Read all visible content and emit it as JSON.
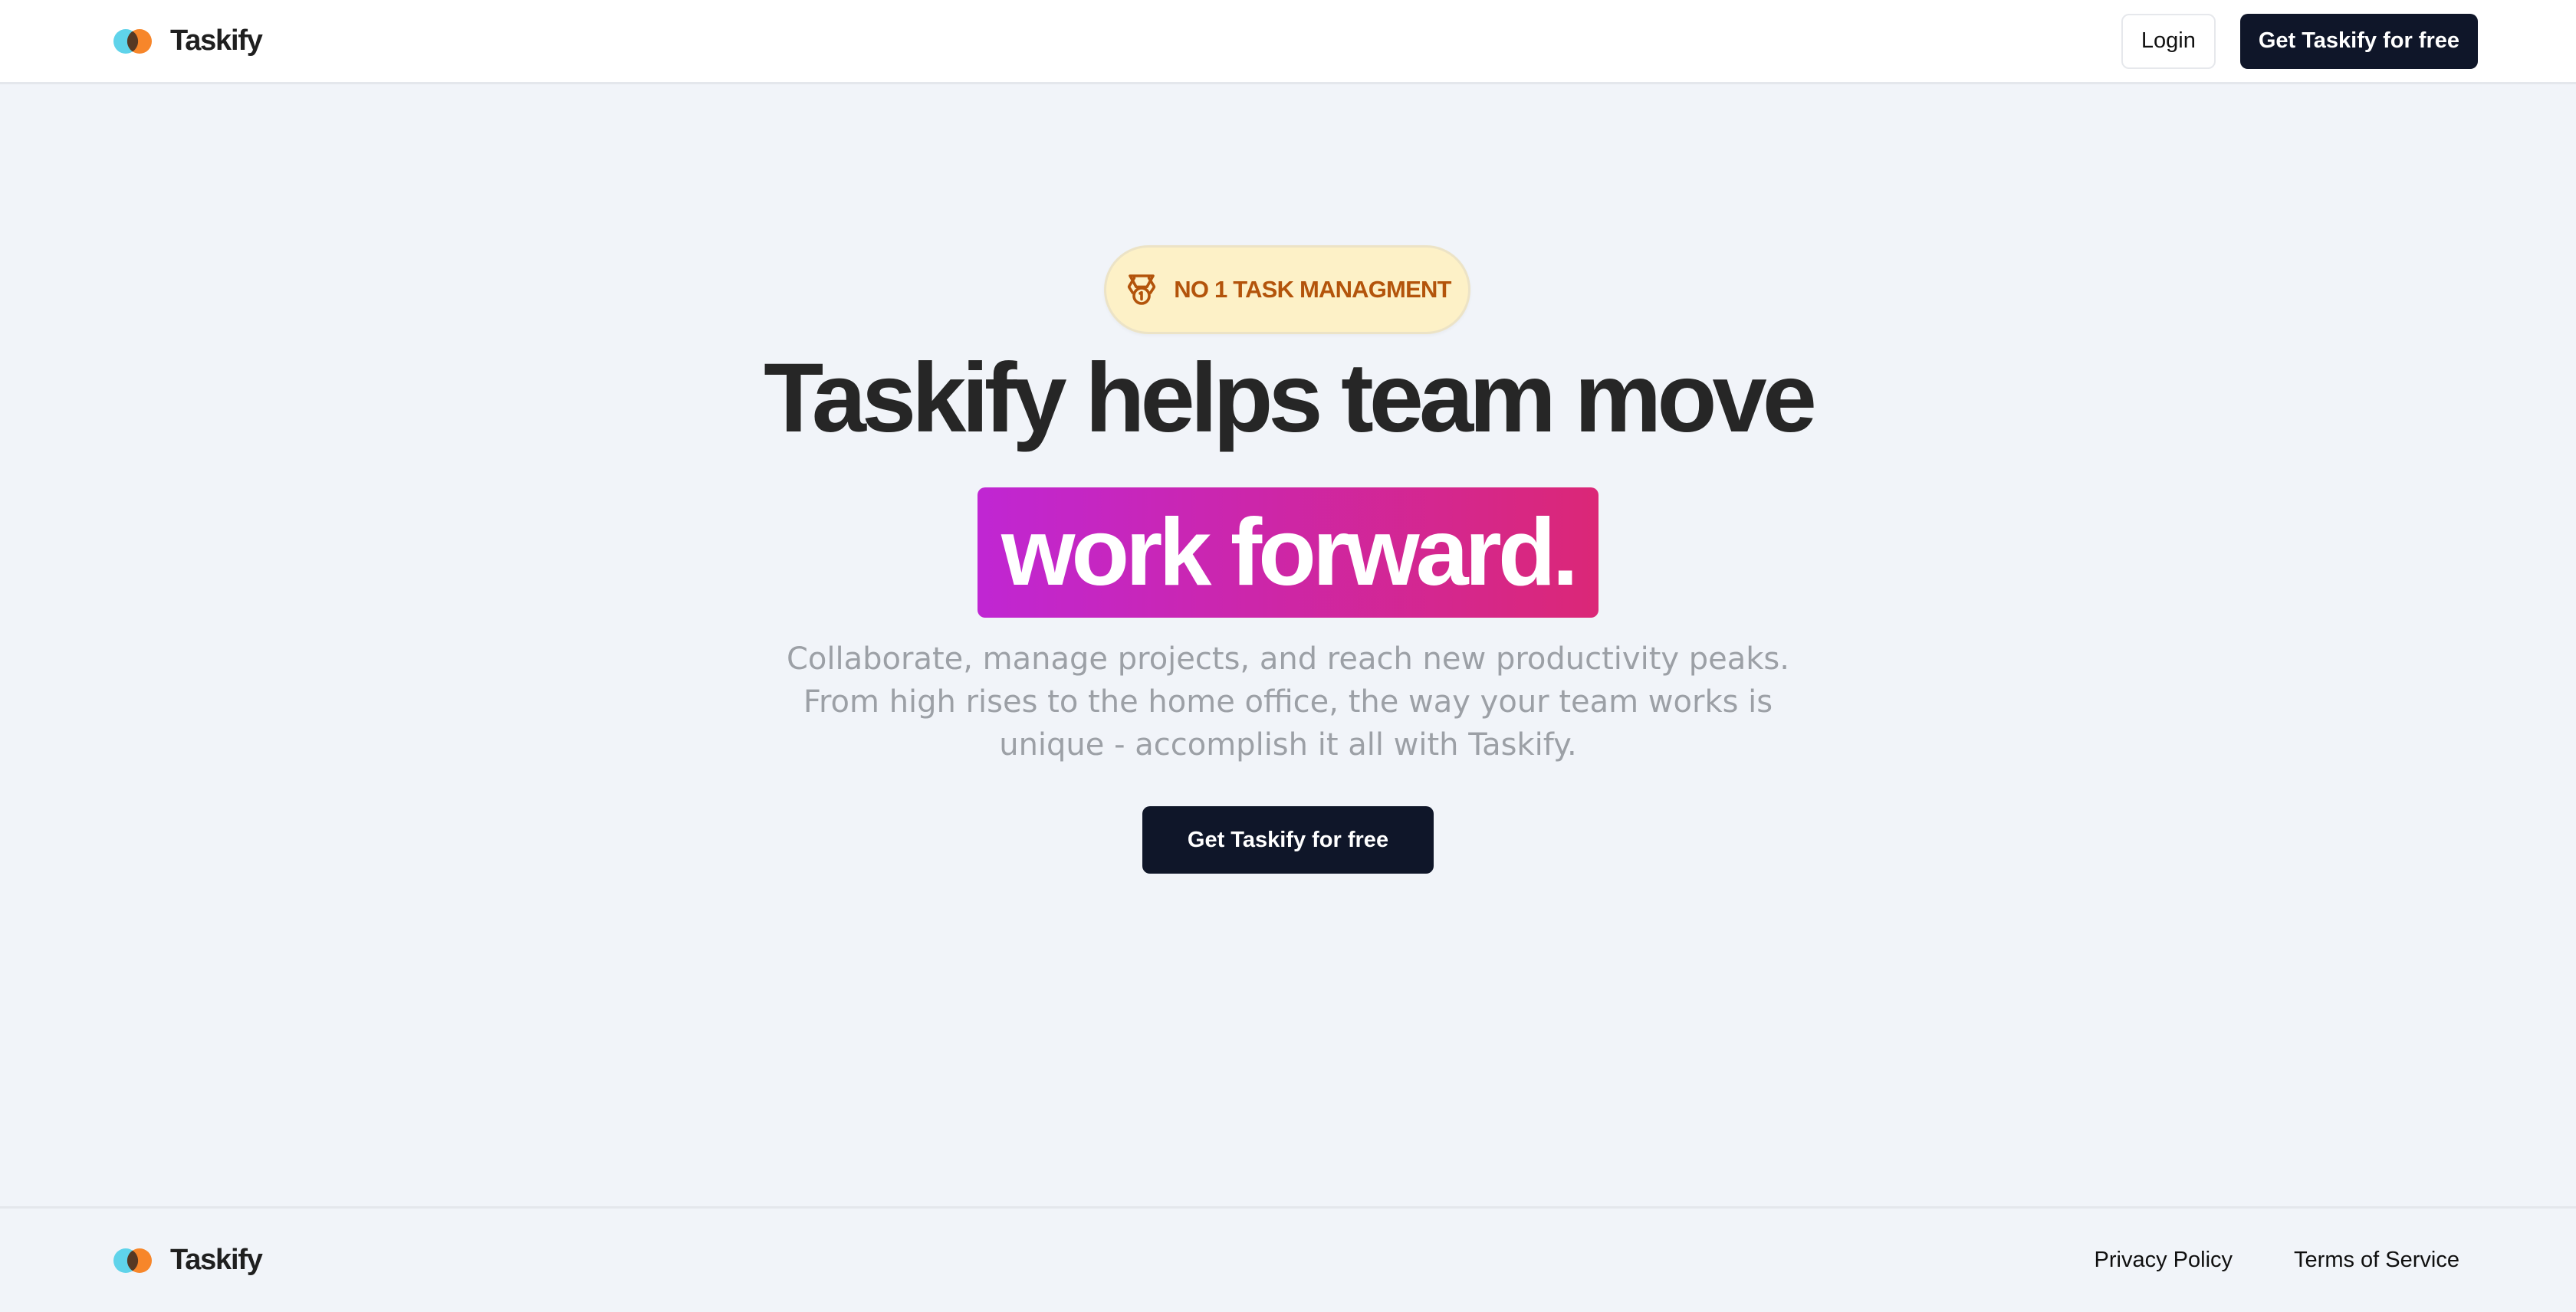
{
  "header": {
    "brand_name": "Taskify",
    "login_label": "Login",
    "cta_label": "Get Taskify for free"
  },
  "hero": {
    "badge_icon": "medal-icon",
    "badge_text": "NO 1 TASK MANAGMENT",
    "headline": "Taskify helps team move",
    "highlight": "work forward.",
    "subtitle_lines": [
      "Collaborate, manage projects, and reach new productivity peaks.",
      "From high rises to the home office, the way your team works is",
      "unique - accomplish it all with Taskify."
    ],
    "cta_label": "Get Taskify for free"
  },
  "footer": {
    "brand_name": "Taskify",
    "privacy_label": "Privacy Policy",
    "terms_label": "Terms of Service"
  },
  "colors": {
    "background": "#f1f4f9",
    "dark_button": "#0f1629",
    "badge_bg": "#fdf1c7",
    "badge_text": "#b3540b",
    "gradient_start": "#c026d3",
    "gradient_end": "#db2777",
    "logo_cyan": "#5fd3ea",
    "logo_orange": "#f7862a"
  }
}
